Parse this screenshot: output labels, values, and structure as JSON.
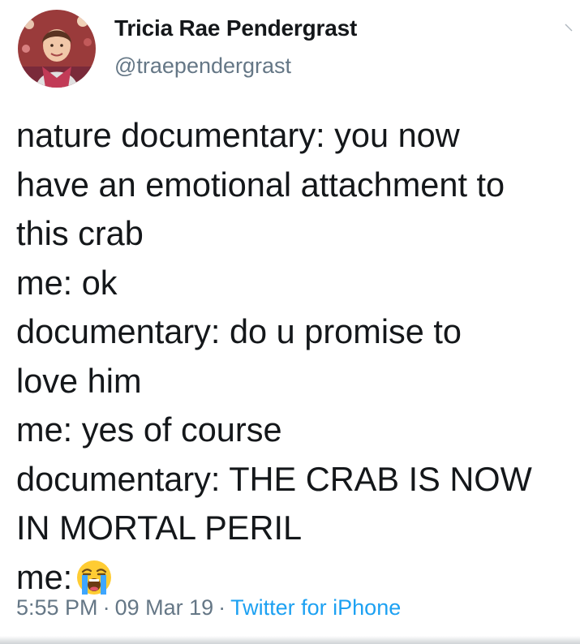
{
  "author": {
    "name": "Tricia Rae Pendergrast",
    "handle": "@traependergrast"
  },
  "tweet": {
    "lines": [
      "nature documentary: you now",
      "have an emotional attachment to",
      "this crab",
      "me: ok",
      "documentary: do u promise to",
      "love him",
      "me: yes of course",
      "documentary: THE CRAB IS NOW",
      "IN MORTAL PERIL",
      "me:"
    ],
    "final_emoji": "loudly-crying-face-emoji"
  },
  "meta": {
    "time": "5:55 PM",
    "separator": "·",
    "date": "09 Mar 19",
    "source": "Twitter for iPhone"
  }
}
